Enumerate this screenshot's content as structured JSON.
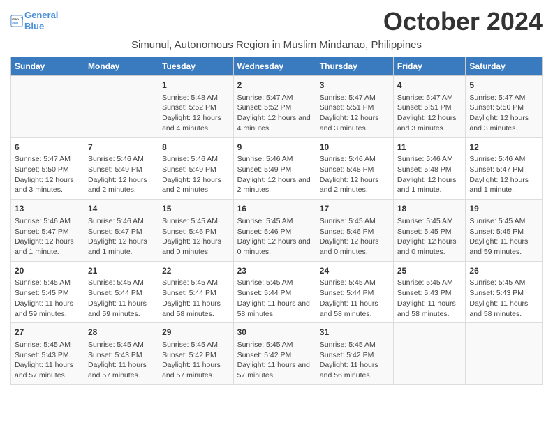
{
  "logo": {
    "line1": "General",
    "line2": "Blue"
  },
  "title": "October 2024",
  "subtitle": "Simunul, Autonomous Region in Muslim Mindanao, Philippines",
  "days_of_week": [
    "Sunday",
    "Monday",
    "Tuesday",
    "Wednesday",
    "Thursday",
    "Friday",
    "Saturday"
  ],
  "weeks": [
    [
      {
        "day": "",
        "info": ""
      },
      {
        "day": "",
        "info": ""
      },
      {
        "day": "1",
        "info": "Sunrise: 5:48 AM\nSunset: 5:52 PM\nDaylight: 12 hours and 4 minutes."
      },
      {
        "day": "2",
        "info": "Sunrise: 5:47 AM\nSunset: 5:52 PM\nDaylight: 12 hours and 4 minutes."
      },
      {
        "day": "3",
        "info": "Sunrise: 5:47 AM\nSunset: 5:51 PM\nDaylight: 12 hours and 3 minutes."
      },
      {
        "day": "4",
        "info": "Sunrise: 5:47 AM\nSunset: 5:51 PM\nDaylight: 12 hours and 3 minutes."
      },
      {
        "day": "5",
        "info": "Sunrise: 5:47 AM\nSunset: 5:50 PM\nDaylight: 12 hours and 3 minutes."
      }
    ],
    [
      {
        "day": "6",
        "info": "Sunrise: 5:47 AM\nSunset: 5:50 PM\nDaylight: 12 hours and 3 minutes."
      },
      {
        "day": "7",
        "info": "Sunrise: 5:46 AM\nSunset: 5:49 PM\nDaylight: 12 hours and 2 minutes."
      },
      {
        "day": "8",
        "info": "Sunrise: 5:46 AM\nSunset: 5:49 PM\nDaylight: 12 hours and 2 minutes."
      },
      {
        "day": "9",
        "info": "Sunrise: 5:46 AM\nSunset: 5:49 PM\nDaylight: 12 hours and 2 minutes."
      },
      {
        "day": "10",
        "info": "Sunrise: 5:46 AM\nSunset: 5:48 PM\nDaylight: 12 hours and 2 minutes."
      },
      {
        "day": "11",
        "info": "Sunrise: 5:46 AM\nSunset: 5:48 PM\nDaylight: 12 hours and 1 minute."
      },
      {
        "day": "12",
        "info": "Sunrise: 5:46 AM\nSunset: 5:47 PM\nDaylight: 12 hours and 1 minute."
      }
    ],
    [
      {
        "day": "13",
        "info": "Sunrise: 5:46 AM\nSunset: 5:47 PM\nDaylight: 12 hours and 1 minute."
      },
      {
        "day": "14",
        "info": "Sunrise: 5:46 AM\nSunset: 5:47 PM\nDaylight: 12 hours and 1 minute."
      },
      {
        "day": "15",
        "info": "Sunrise: 5:45 AM\nSunset: 5:46 PM\nDaylight: 12 hours and 0 minutes."
      },
      {
        "day": "16",
        "info": "Sunrise: 5:45 AM\nSunset: 5:46 PM\nDaylight: 12 hours and 0 minutes."
      },
      {
        "day": "17",
        "info": "Sunrise: 5:45 AM\nSunset: 5:46 PM\nDaylight: 12 hours and 0 minutes."
      },
      {
        "day": "18",
        "info": "Sunrise: 5:45 AM\nSunset: 5:45 PM\nDaylight: 12 hours and 0 minutes."
      },
      {
        "day": "19",
        "info": "Sunrise: 5:45 AM\nSunset: 5:45 PM\nDaylight: 11 hours and 59 minutes."
      }
    ],
    [
      {
        "day": "20",
        "info": "Sunrise: 5:45 AM\nSunset: 5:45 PM\nDaylight: 11 hours and 59 minutes."
      },
      {
        "day": "21",
        "info": "Sunrise: 5:45 AM\nSunset: 5:44 PM\nDaylight: 11 hours and 59 minutes."
      },
      {
        "day": "22",
        "info": "Sunrise: 5:45 AM\nSunset: 5:44 PM\nDaylight: 11 hours and 58 minutes."
      },
      {
        "day": "23",
        "info": "Sunrise: 5:45 AM\nSunset: 5:44 PM\nDaylight: 11 hours and 58 minutes."
      },
      {
        "day": "24",
        "info": "Sunrise: 5:45 AM\nSunset: 5:44 PM\nDaylight: 11 hours and 58 minutes."
      },
      {
        "day": "25",
        "info": "Sunrise: 5:45 AM\nSunset: 5:43 PM\nDaylight: 11 hours and 58 minutes."
      },
      {
        "day": "26",
        "info": "Sunrise: 5:45 AM\nSunset: 5:43 PM\nDaylight: 11 hours and 58 minutes."
      }
    ],
    [
      {
        "day": "27",
        "info": "Sunrise: 5:45 AM\nSunset: 5:43 PM\nDaylight: 11 hours and 57 minutes."
      },
      {
        "day": "28",
        "info": "Sunrise: 5:45 AM\nSunset: 5:43 PM\nDaylight: 11 hours and 57 minutes."
      },
      {
        "day": "29",
        "info": "Sunrise: 5:45 AM\nSunset: 5:42 PM\nDaylight: 11 hours and 57 minutes."
      },
      {
        "day": "30",
        "info": "Sunrise: 5:45 AM\nSunset: 5:42 PM\nDaylight: 11 hours and 57 minutes."
      },
      {
        "day": "31",
        "info": "Sunrise: 5:45 AM\nSunset: 5:42 PM\nDaylight: 11 hours and 56 minutes."
      },
      {
        "day": "",
        "info": ""
      },
      {
        "day": "",
        "info": ""
      }
    ]
  ]
}
